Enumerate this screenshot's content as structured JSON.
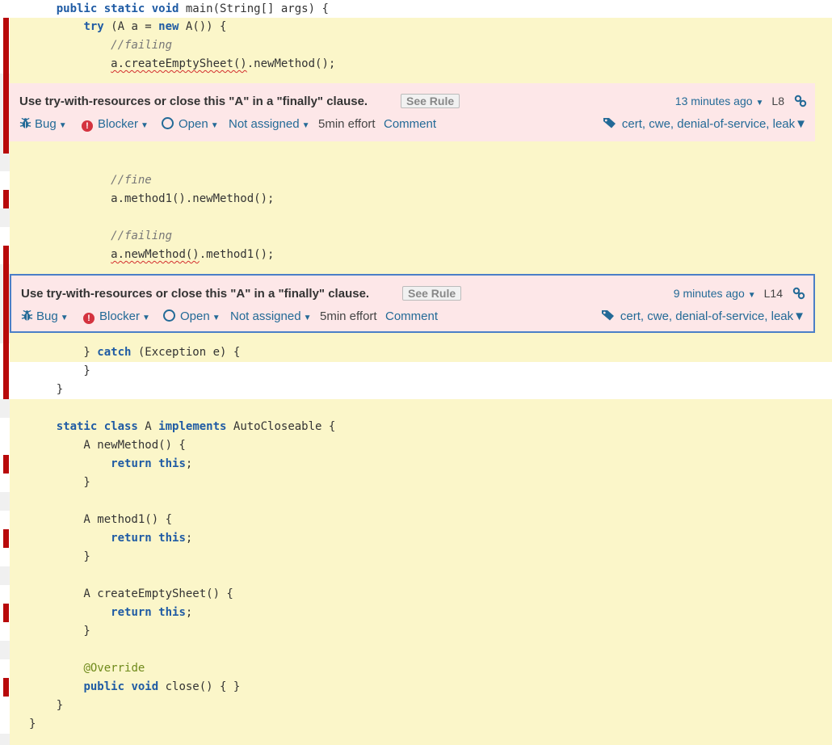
{
  "code_lines": [
    {
      "segments": [
        [
          "    ",
          ""
        ],
        [
          "public static void",
          "kw"
        ],
        [
          " main(String[] args) {",
          ""
        ]
      ]
    },
    {
      "segments": [
        [
          "        ",
          ""
        ],
        [
          "try",
          "kw"
        ],
        [
          " (A a = ",
          ""
        ],
        [
          "new",
          "kw"
        ],
        [
          " A()) {",
          ""
        ]
      ]
    },
    {
      "segments": [
        [
          "            ",
          ""
        ],
        [
          "//failing",
          "cm"
        ]
      ]
    },
    {
      "segments": [
        [
          "            ",
          ""
        ],
        [
          "a.createEmptySheet()",
          "sq"
        ],
        [
          ".newMethod();",
          ""
        ]
      ]
    },
    {
      "segments": [
        [
          "            ",
          ""
        ],
        [
          "//fine",
          "cm"
        ]
      ]
    },
    {
      "segments": [
        [
          "            a.method1().newMethod();",
          ""
        ]
      ]
    },
    {
      "segments": [
        [
          "            ",
          ""
        ],
        [
          "//failing",
          "cm"
        ]
      ]
    },
    {
      "segments": [
        [
          "            ",
          ""
        ],
        [
          "a.newMethod()",
          "sq"
        ],
        [
          ".method1();",
          ""
        ]
      ]
    },
    {
      "segments": [
        [
          "        } ",
          ""
        ],
        [
          "catch",
          "kw"
        ],
        [
          " (Exception e) {",
          ""
        ]
      ]
    },
    {
      "segments": [
        [
          "        }",
          ""
        ]
      ]
    },
    {
      "segments": [
        [
          "    }",
          ""
        ]
      ]
    },
    {
      "segments": [
        [
          "    ",
          ""
        ],
        [
          "static class",
          "kw"
        ],
        [
          " A ",
          ""
        ],
        [
          "implements",
          "kw"
        ],
        [
          " AutoCloseable {",
          ""
        ]
      ]
    },
    {
      "segments": [
        [
          "        A newMethod() {",
          ""
        ]
      ]
    },
    {
      "segments": [
        [
          "            ",
          ""
        ],
        [
          "return this",
          "kw"
        ],
        [
          ";",
          ""
        ]
      ]
    },
    {
      "segments": [
        [
          "        }",
          ""
        ]
      ]
    },
    {
      "segments": [
        [
          "        A method1() {",
          ""
        ]
      ]
    },
    {
      "segments": [
        [
          "            ",
          ""
        ],
        [
          "return this",
          "kw"
        ],
        [
          ";",
          ""
        ]
      ]
    },
    {
      "segments": [
        [
          "        }",
          ""
        ]
      ]
    },
    {
      "segments": [
        [
          "        A createEmptySheet() {",
          ""
        ]
      ]
    },
    {
      "segments": [
        [
          "            ",
          ""
        ],
        [
          "return this",
          "kw"
        ],
        [
          ";",
          ""
        ]
      ]
    },
    {
      "segments": [
        [
          "        }",
          ""
        ]
      ]
    },
    {
      "segments": [
        [
          "        ",
          ""
        ],
        [
          "@Override",
          "an"
        ]
      ]
    },
    {
      "segments": [
        [
          "        ",
          ""
        ],
        [
          "public void",
          "kw"
        ],
        [
          " close() { }",
          ""
        ]
      ]
    },
    {
      "segments": [
        [
          "    }",
          ""
        ]
      ]
    },
    {
      "segments": [
        [
          "}",
          ""
        ]
      ]
    }
  ],
  "issues": [
    {
      "message": "Use try-with-resources or close this \"A\" in a \"finally\" clause.",
      "see_rule": "See Rule",
      "time": "13 minutes ago",
      "line": "L8",
      "type": "Bug",
      "severity": "Blocker",
      "status": "Open",
      "assignee": "Not assigned",
      "effort": "5min effort",
      "comment": "Comment",
      "tags": "cert, cwe, denial-of-service, leak"
    },
    {
      "message": "Use try-with-resources or close this \"A\" in a \"finally\" clause.",
      "see_rule": "See Rule",
      "time": "9 minutes ago",
      "line": "L14",
      "type": "Bug",
      "severity": "Blocker",
      "status": "Open",
      "assignee": "Not assigned",
      "effort": "5min effort",
      "comment": "Comment",
      "tags": "cert, cwe, denial-of-service, leak"
    }
  ],
  "icons": {
    "bug": "bug-icon",
    "blocker": "blocker-severity-icon",
    "open": "open-status-icon",
    "tags": "tag-icon",
    "permalink": "link-icon",
    "dropdown": "caret-down-icon"
  },
  "colors": {
    "issue_marker": "#b8090a",
    "highlight": "#fbf6c9",
    "issue_background": "#fde7e8",
    "selected_border": "#4b7fc7",
    "link": "#236a97",
    "keyword": "#1f5ba4"
  }
}
